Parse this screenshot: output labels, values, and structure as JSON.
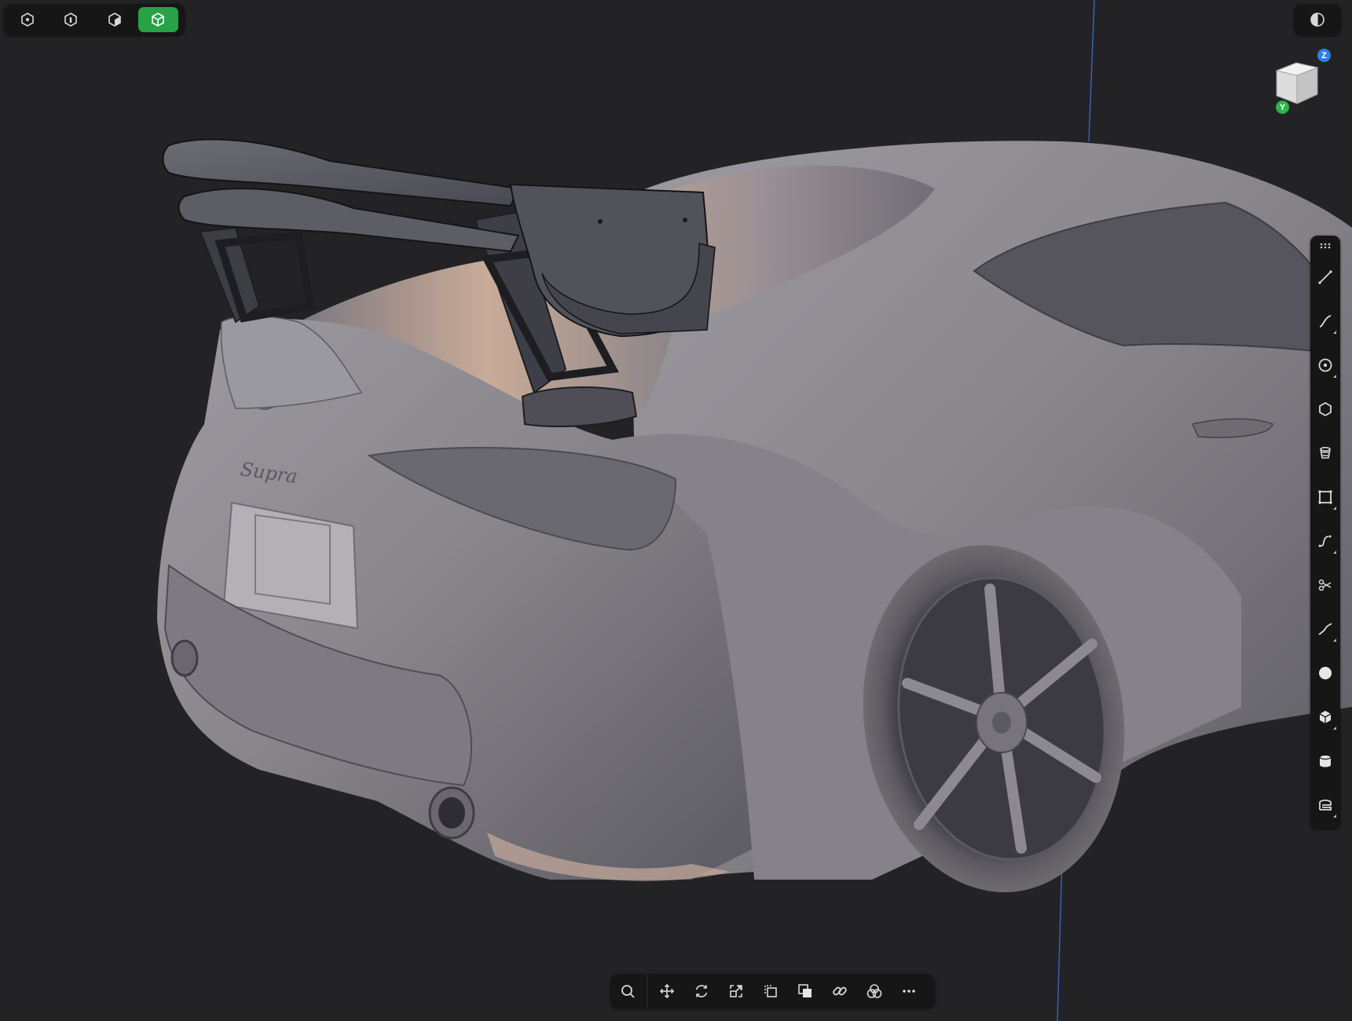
{
  "mode_bar": {
    "items": [
      {
        "name": "point-mode",
        "icon": "vertex-select-icon",
        "active": false
      },
      {
        "name": "edge-mode",
        "icon": "edge-select-icon",
        "active": false
      },
      {
        "name": "face-mode",
        "icon": "face-select-icon",
        "active": false
      },
      {
        "name": "object-mode",
        "icon": "object-select-icon",
        "active": true
      }
    ],
    "active_color": "#27a246"
  },
  "display_toggle": {
    "icon": "render-mode-icon"
  },
  "view_cube": {
    "axes": {
      "z": "Z",
      "y": "Y"
    },
    "z_color": "#2f7ee6",
    "y_color": "#2bb34c"
  },
  "tool_strip": {
    "grip_icon": "grip-dots-icon",
    "tools": [
      {
        "name": "line-tool",
        "icon": "line-icon",
        "has_submenu": false
      },
      {
        "name": "curve-tool",
        "icon": "curve-icon",
        "has_submenu": true
      },
      {
        "name": "circle-tool",
        "icon": "circle-icon",
        "has_submenu": true
      },
      {
        "name": "polygon-tool",
        "icon": "polygon-icon",
        "has_submenu": false
      },
      {
        "name": "surface-tool",
        "icon": "surface-icon",
        "has_submenu": false
      },
      {
        "name": "rectangle-tool",
        "icon": "rectangle-icon",
        "has_submenu": true
      },
      {
        "name": "spline-tool",
        "icon": "spline-icon",
        "has_submenu": true
      },
      {
        "name": "trim-tool",
        "icon": "trim-icon",
        "has_submenu": false
      },
      {
        "name": "blend-curve-tool",
        "icon": "blend-curve-icon",
        "has_submenu": true
      },
      {
        "name": "sphere-tool",
        "icon": "sphere-icon",
        "has_submenu": false
      },
      {
        "name": "box-tool",
        "icon": "box-icon",
        "has_submenu": true
      },
      {
        "name": "cylinder-tool",
        "icon": "cylinder-icon",
        "has_submenu": false
      },
      {
        "name": "text-tool",
        "icon": "text-icon",
        "has_submenu": true
      }
    ]
  },
  "bottom_toolbar": {
    "search": {
      "icon": "search-icon"
    },
    "tools": [
      {
        "name": "move",
        "icon": "move-icon"
      },
      {
        "name": "rotate",
        "icon": "rotate-icon"
      },
      {
        "name": "scale",
        "icon": "scale-icon"
      },
      {
        "name": "duplicate",
        "icon": "duplicate-icon"
      },
      {
        "name": "boolean",
        "icon": "boolean-icon"
      },
      {
        "name": "link",
        "icon": "link-icon"
      },
      {
        "name": "material",
        "icon": "material-icon"
      },
      {
        "name": "more",
        "icon": "more-icon"
      }
    ]
  },
  "scene": {
    "model_color": "#8f8c8f",
    "highlight_color": "#c4a99a",
    "shadow_color": "#4a4a52",
    "badge_text": "Supra"
  }
}
